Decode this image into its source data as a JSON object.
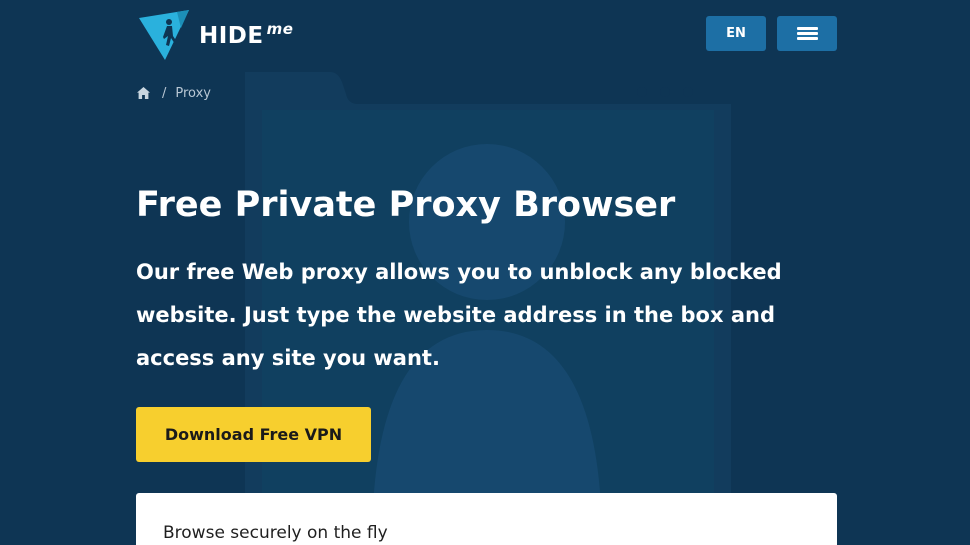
{
  "brand": {
    "logo_text": "HIDE",
    "logo_suffix": "me",
    "accent_color": "#2ab1dd"
  },
  "header": {
    "language_label": "EN",
    "menu_icon": "hamburger-icon"
  },
  "breadcrumb": {
    "home_icon": "home-icon",
    "separator": "/",
    "current": "Proxy"
  },
  "hero": {
    "title": "Free Private Proxy Browser",
    "description": "Our free Web proxy allows you to unblock any blocked website. Just type the website address in the box and access any site you want.",
    "cta_label": "Download Free VPN",
    "cta_color": "#f7cf2e"
  },
  "card": {
    "title": "Browse securely on the fly"
  },
  "theme": {
    "background": "#0e3554",
    "button_blue": "#1d6fa5"
  }
}
